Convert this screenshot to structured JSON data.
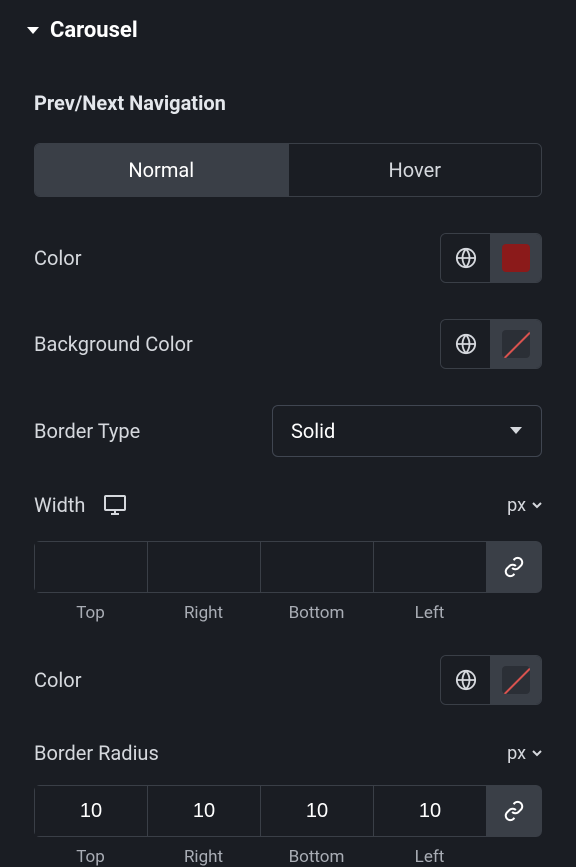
{
  "section": {
    "title": "Carousel"
  },
  "subheading": "Prev/Next Navigation",
  "tabs": {
    "normal": "Normal",
    "hover": "Hover"
  },
  "labels": {
    "color": "Color",
    "bgcolor": "Background Color",
    "borderType": "Border Type",
    "width": "Width",
    "borderRadius": "Border Radius"
  },
  "borderType": {
    "value": "Solid"
  },
  "units": {
    "width": "px",
    "radius": "px"
  },
  "widthInputs": {
    "top": "",
    "right": "",
    "bottom": "",
    "left": ""
  },
  "radiusInputs": {
    "top": "10",
    "right": "10",
    "bottom": "10",
    "left": "10"
  },
  "dimLabels": {
    "top": "Top",
    "right": "Right",
    "bottom": "Bottom",
    "left": "Left"
  }
}
